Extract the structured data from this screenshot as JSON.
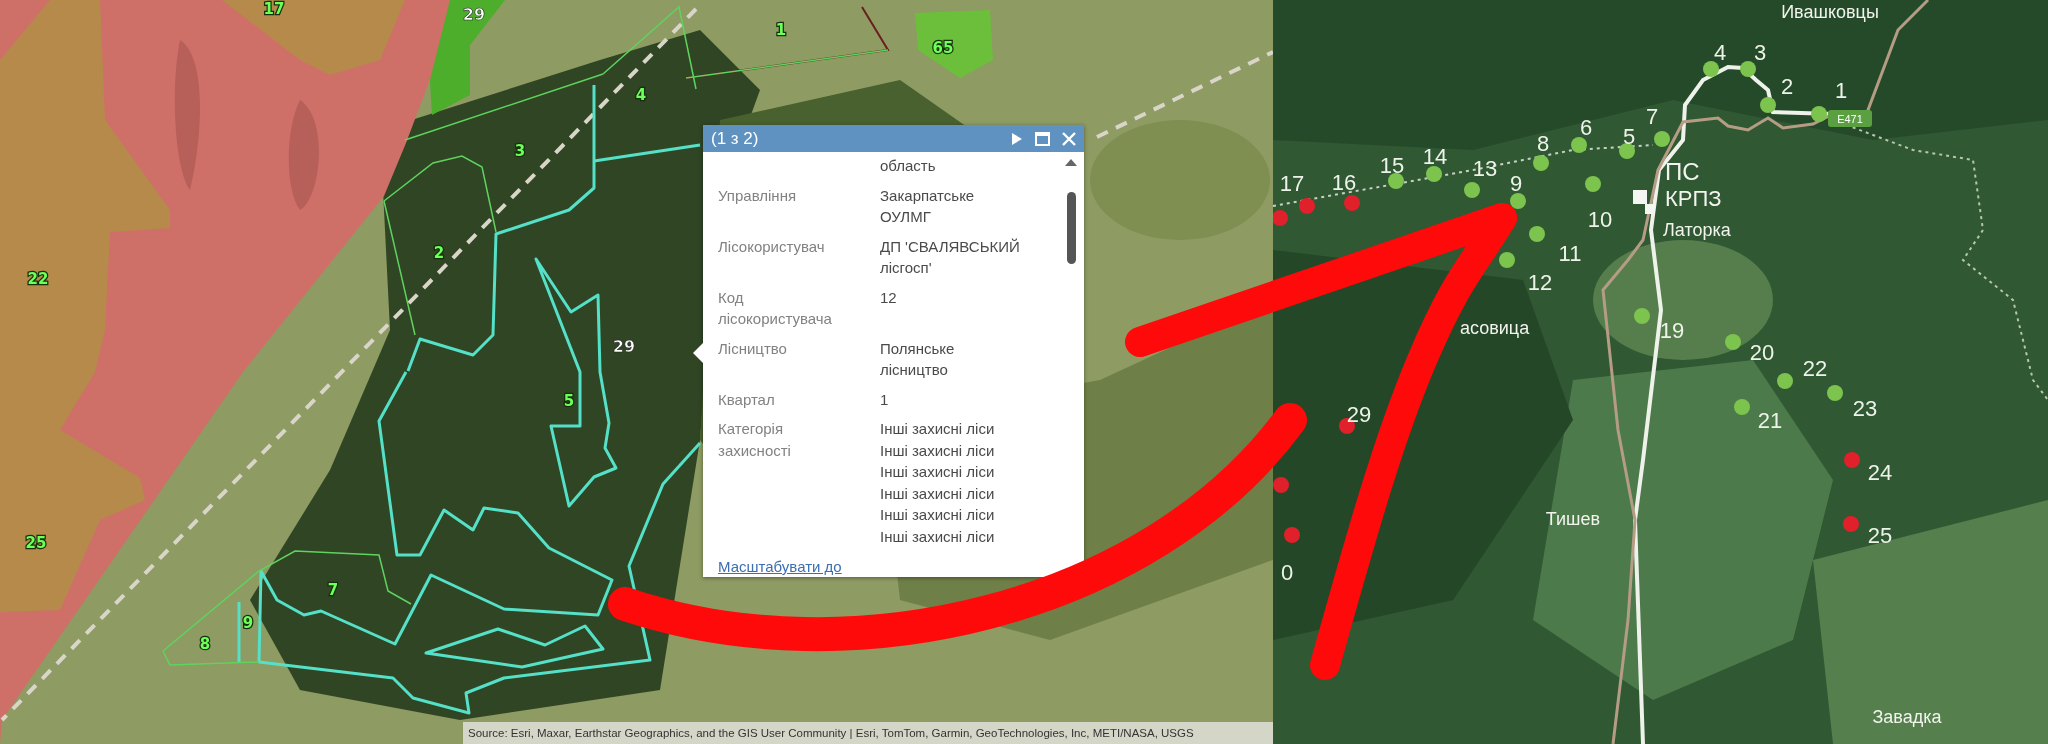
{
  "left_map": {
    "labels": [
      {
        "text": "17",
        "kind": "parcel"
      },
      {
        "text": "29",
        "kind": "compartment"
      },
      {
        "text": "1",
        "kind": "parcel"
      },
      {
        "text": "65",
        "kind": "parcel"
      },
      {
        "text": "4",
        "kind": "parcel"
      },
      {
        "text": "3",
        "kind": "parcel"
      },
      {
        "text": "2",
        "kind": "parcel"
      },
      {
        "text": "22",
        "kind": "parcel"
      },
      {
        "text": "29",
        "kind": "compartment"
      },
      {
        "text": "5",
        "kind": "parcel"
      },
      {
        "text": "25",
        "kind": "parcel"
      },
      {
        "text": "7",
        "kind": "parcel"
      },
      {
        "text": "9",
        "kind": "parcel"
      },
      {
        "text": "8",
        "kind": "parcel"
      }
    ],
    "popup": {
      "title": "(1 з 2)",
      "rows": [
        {
          "lines": [
            "область"
          ]
        },
        {
          "label": "Управління",
          "lines": [
            "Закарпатське",
            "ОУЛМГ"
          ]
        },
        {
          "label": "Лісокористувач",
          "lines": [
            "ДП 'СВАЛЯВСЬКИЙ",
            "лісгосп'"
          ]
        },
        {
          "label": "Код лісокористувача",
          "lines": [
            "12"
          ]
        },
        {
          "label": "Лісництво",
          "lines": [
            "Полянське",
            "лісництво"
          ]
        },
        {
          "label": "Квартал",
          "lines": [
            "1"
          ]
        },
        {
          "label": "Категорія захисності",
          "lines": [
            "Інші захисні ліси",
            "Інші захисні ліси",
            "Інші захисні ліси",
            "Інші захисні ліси",
            "Інші захисні ліси",
            "Інші захисні ліси"
          ]
        }
      ],
      "link": "Масштабувати до"
    },
    "attribution": "Source: Esri, Maxar, Earthstar Geographics, and the GIS User Community | Esri, TomTom, Garmin, GeoTechnologies, Inc, METI/NASA, USGS"
  },
  "right_map": {
    "places": [
      "Ивашковцы",
      "ПС",
      "КРПЗ",
      "Латорка",
      "асовица",
      "Тишев",
      "Завадка"
    ],
    "road_sign": "E471",
    "points": [
      {
        "label": "4",
        "color": "#7cc44e"
      },
      {
        "label": "3",
        "color": "#7cc44e"
      },
      {
        "label": "2",
        "color": "#7cc44e"
      },
      {
        "label": "1",
        "color": "#7cc44e"
      },
      {
        "label": "8",
        "color": "#7cc44e"
      },
      {
        "label": "6",
        "color": "#7cc44e"
      },
      {
        "label": "5",
        "color": "#7cc44e"
      },
      {
        "label": "7",
        "color": "#7cc44e"
      },
      {
        "label": "17",
        "color": "#e0202a"
      },
      {
        "label": "16",
        "color": "#e0202a"
      },
      {
        "label": "15",
        "color": "#7cc44e"
      },
      {
        "label": "14",
        "color": "#7cc44e"
      },
      {
        "label": "13",
        "color": "#7cc44e"
      },
      {
        "label": "9",
        "color": "#7cc44e"
      },
      {
        "color": "#e0202a"
      },
      {
        "label": "10",
        "color": "#7cc44e"
      },
      {
        "label": "11",
        "color": "#7cc44e"
      },
      {
        "label": "12",
        "color": "#7cc44e"
      },
      {
        "label": "19",
        "color": "#7cc44e"
      },
      {
        "label": "20",
        "color": "#7cc44e"
      },
      {
        "label": "22",
        "color": "#7cc44e"
      },
      {
        "label": "29",
        "color": "#e0202a"
      },
      {
        "label": "21",
        "color": "#7cc44e"
      },
      {
        "label": "23",
        "color": "#7cc44e"
      },
      {
        "color": "#e0202a"
      },
      {
        "label": "24",
        "color": "#e0202a"
      },
      {
        "label": "25",
        "color": "#e0202a"
      },
      {
        "label": "0",
        "color": "#e0202a"
      }
    ]
  }
}
